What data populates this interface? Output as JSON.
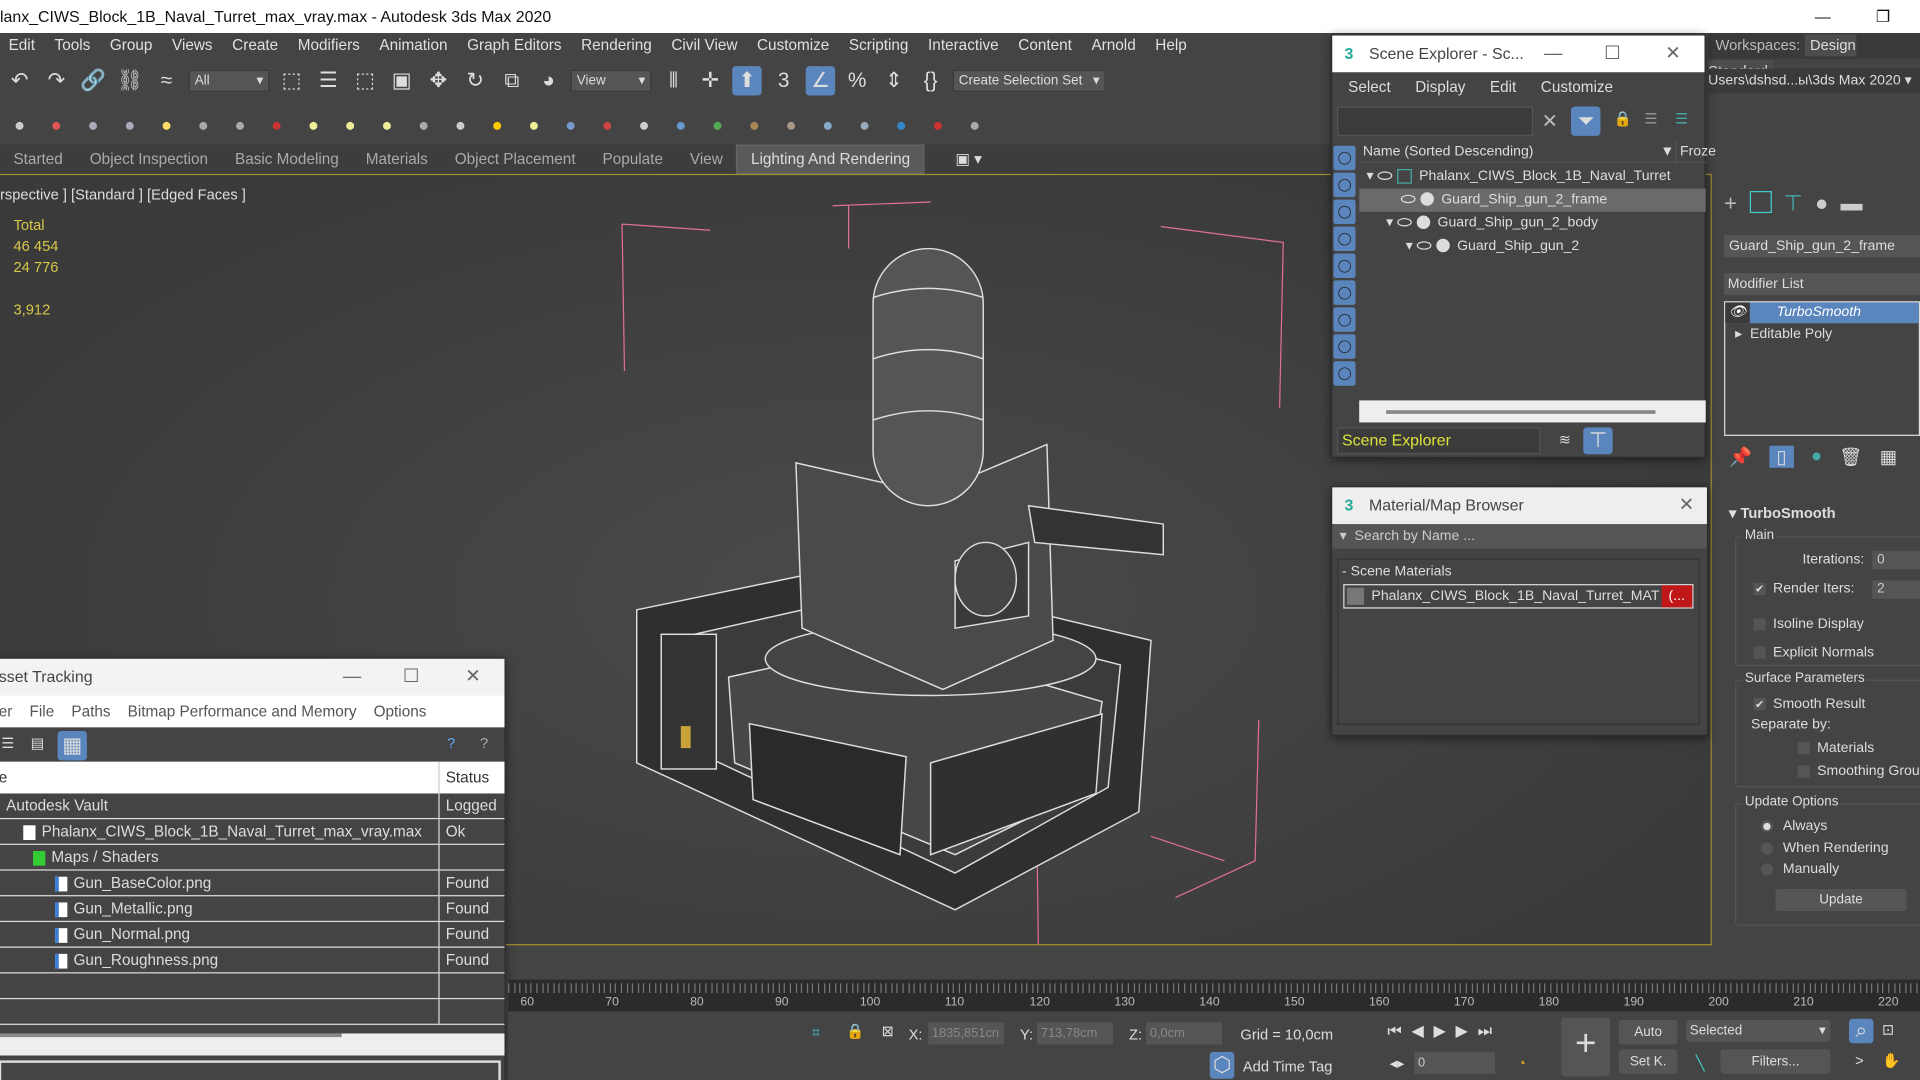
{
  "window": {
    "title": "lanx_CIWS_Block_1B_Naval_Turret_max_vray.max - Autodesk 3ds Max 2020",
    "minimize": "—",
    "restore": "❐"
  },
  "menu": [
    "Edit",
    "Tools",
    "Group",
    "Views",
    "Create",
    "Modifiers",
    "Animation",
    "Graph Editors",
    "Rendering",
    "Civil View",
    "Customize",
    "Scripting",
    "Interactive",
    "Content",
    "Arnold",
    "Help"
  ],
  "workspace": {
    "label": "Workspaces:",
    "value": "Design Standard",
    "path": "Users\\dshsd...ы\\3ds Max 2020"
  },
  "toolbar": {
    "filter_dropdown": "All",
    "view_dropdown": "View",
    "selection_set": "Create Selection Set",
    "row1_icons": [
      "undo-icon",
      "redo-icon",
      "link-icon",
      "unlink-icon",
      "bind-spacewarp-icon"
    ],
    "row1b_icons": [
      "select-object-icon",
      "select-by-name-icon",
      "rect-selection-icon",
      "window-crossing-icon",
      "move-icon",
      "rotate-icon",
      "scale-icon",
      "place-icon"
    ],
    "row1c_icons": [
      "mirror-select-icon",
      "pivot-icon",
      "keyboard-shortcut-icon",
      "snap-3d-icon",
      "angle-snap-icon",
      "percent-snap-icon",
      "spinner-snap-icon",
      "named-selection-icon"
    ],
    "row2_icons": [
      "scene-icon",
      "render-frame-icon",
      "table-icon",
      "table2-icon",
      "light-lister-icon",
      "camera-icon",
      "camera2-icon",
      "camera-rig-icon",
      "box-icon",
      "dome-icon",
      "sphere-light-icon",
      "teapot-icon",
      "cone-icon",
      "sun-icon",
      "ellipse-icon",
      "grid-icon",
      "molecule-icon",
      "tower-icon",
      "gear-cloud-icon",
      "grass-icon",
      "hair-fur-icon",
      "cloth-icon",
      "material-sphere-icon",
      "render-setup-icon",
      "render-icon",
      "render-frame2-icon",
      "help-icon"
    ]
  },
  "ribbon": {
    "tabs": [
      "Started",
      "Object Inspection",
      "Basic Modeling",
      "Materials",
      "Object Placement",
      "Populate",
      "View",
      "Lighting And Rendering"
    ],
    "active": "Lighting And Rendering"
  },
  "viewport": {
    "label": "rspective ] [Standard ] [Edged Faces ]",
    "stats": {
      "header": "Total",
      "polys": "46 454",
      "verts": "24 776",
      "fps": "3,912"
    }
  },
  "scene_explorer": {
    "title": "Scene Explorer - Sc...",
    "menu": [
      "Select",
      "Display",
      "Edit",
      "Customize"
    ],
    "column": "Name (Sorted Descending)",
    "column2": "Froze",
    "items": [
      {
        "name": "Phalanx_CIWS_Block_1B_Naval_Turret",
        "level": 0
      },
      {
        "name": "Guard_Ship_gun_2_frame",
        "level": 1,
        "selected": true
      },
      {
        "name": "Guard_Ship_gun_2_body",
        "level": 1
      },
      {
        "name": "Guard_Ship_gun_2",
        "level": 2
      }
    ],
    "footer": "Scene Explorer"
  },
  "material_browser": {
    "title": "Material/Map Browser",
    "search_placeholder": "Search by Name ...",
    "section": "- Scene Materials",
    "material": "Phalanx_CIWS_Block_1B_Naval_Turret_MAT",
    "badge": "(..."
  },
  "asset_tracking": {
    "title": "sset Tracking",
    "menu": [
      "er",
      "File",
      "Paths",
      "Bitmap Performance and Memory",
      "Options"
    ],
    "col_name": "e",
    "col_status": "Status",
    "rows": [
      {
        "name": "Autodesk Vault",
        "status": "Logged",
        "indent": 0
      },
      {
        "name": "Phalanx_CIWS_Block_1B_Naval_Turret_max_vray.max",
        "status": "Ok",
        "indent": 1
      },
      {
        "name": "Maps / Shaders",
        "status": "",
        "indent": 2
      },
      {
        "name": "Gun_BaseColor.png",
        "status": "Found",
        "indent": 3
      },
      {
        "name": "Gun_Metallic.png",
        "status": "Found",
        "indent": 3
      },
      {
        "name": "Gun_Normal.png",
        "status": "Found",
        "indent": 3
      },
      {
        "name": "Gun_Roughness.png",
        "status": "Found",
        "indent": 3
      }
    ]
  },
  "command_panel": {
    "object_name": "Guard_Ship_gun_2_frame",
    "modifier_list": "Modifier List",
    "stack": [
      "TurboSmooth",
      "Editable Poly"
    ],
    "rollout": "TurboSmooth",
    "main": "Main",
    "iterations_label": "Iterations:",
    "iterations": "0",
    "render_iters_label": "Render Iters:",
    "render_iters": "2",
    "isoline": "Isoline Display",
    "explicit_normals": "Explicit Normals",
    "surface": "Surface Parameters",
    "smooth_result": "Smooth Result",
    "separate_by": "Separate by:",
    "materials": "Materials",
    "smoothing_groups": "Smoothing Groups",
    "update_options": "Update Options",
    "always": "Always",
    "when_rendering": "When Rendering",
    "manually": "Manually",
    "update": "Update"
  },
  "timeline": {
    "ticks": [
      "60",
      "70",
      "80",
      "90",
      "100",
      "110",
      "120",
      "130",
      "140",
      "150",
      "160",
      "170",
      "180",
      "190",
      "200",
      "210",
      "220"
    ]
  },
  "status": {
    "x_label": "X:",
    "x": "1835,851cn",
    "y_label": "Y:",
    "y": "713,78cm",
    "z_label": "Z:",
    "z": "0,0cm",
    "grid": "Grid = 10,0cm",
    "add_time_tag": "Add Time Tag",
    "frame": "0",
    "auto": "Auto",
    "setk": "Set K.",
    "selected": "Selected",
    "filters": "Filters..."
  }
}
